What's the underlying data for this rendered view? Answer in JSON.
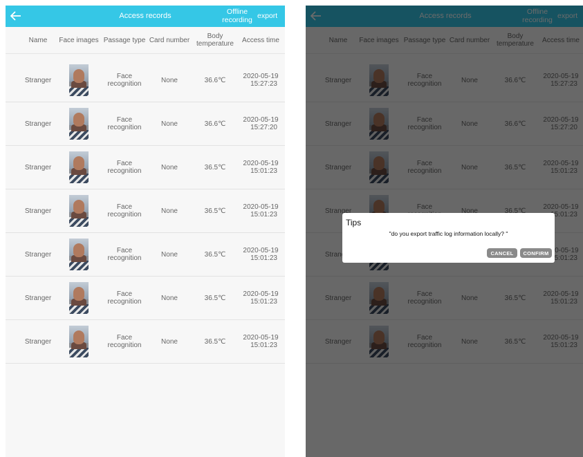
{
  "topbar": {
    "title": "Access records",
    "offline_line1": "Offline",
    "offline_line2": "recording",
    "export": "export"
  },
  "table": {
    "headers": [
      "Name",
      "Face images",
      "Passage type",
      "Card number",
      "Body temperature",
      "Access time"
    ],
    "rows": [
      {
        "name": "Stranger",
        "passage_type": "Face recognition",
        "card_number": "None",
        "temperature": "36.6℃",
        "date": "2020-05-19",
        "time": "15:27:23"
      },
      {
        "name": "Stranger",
        "passage_type": "Face recognition",
        "card_number": "None",
        "temperature": "36.6℃",
        "date": "2020-05-19",
        "time": "15:27:20"
      },
      {
        "name": "Stranger",
        "passage_type": "Face recognition",
        "card_number": "None",
        "temperature": "36.5℃",
        "date": "2020-05-19",
        "time": "15:01:23"
      },
      {
        "name": "Stranger",
        "passage_type": "Face recognition",
        "card_number": "None",
        "temperature": "36.5℃",
        "date": "2020-05-19",
        "time": "15:01:23"
      },
      {
        "name": "Stranger",
        "passage_type": "Face recognition",
        "card_number": "None",
        "temperature": "36.5℃",
        "date": "2020-05-19",
        "time": "15:01:23"
      },
      {
        "name": "Stranger",
        "passage_type": "Face recognition",
        "card_number": "None",
        "temperature": "36.5℃",
        "date": "2020-05-19",
        "time": "15:01:23"
      },
      {
        "name": "Stranger",
        "passage_type": "Face recognition",
        "card_number": "None",
        "temperature": "36.5℃",
        "date": "2020-05-19",
        "time": "15:01:23"
      }
    ]
  },
  "dialog": {
    "title": "Tips",
    "message": "\"do you export traffic log information locally? \"",
    "cancel": "CANCEL",
    "confirm": "CONFIRM"
  },
  "icons": {
    "back": "arrow-left-icon",
    "face_image": "face-thumbnail"
  },
  "colors": {
    "topbar": "#35c7e6",
    "overlay": "rgba(0,0,0,0.58)",
    "dialog_button": "#8a8a8a"
  }
}
